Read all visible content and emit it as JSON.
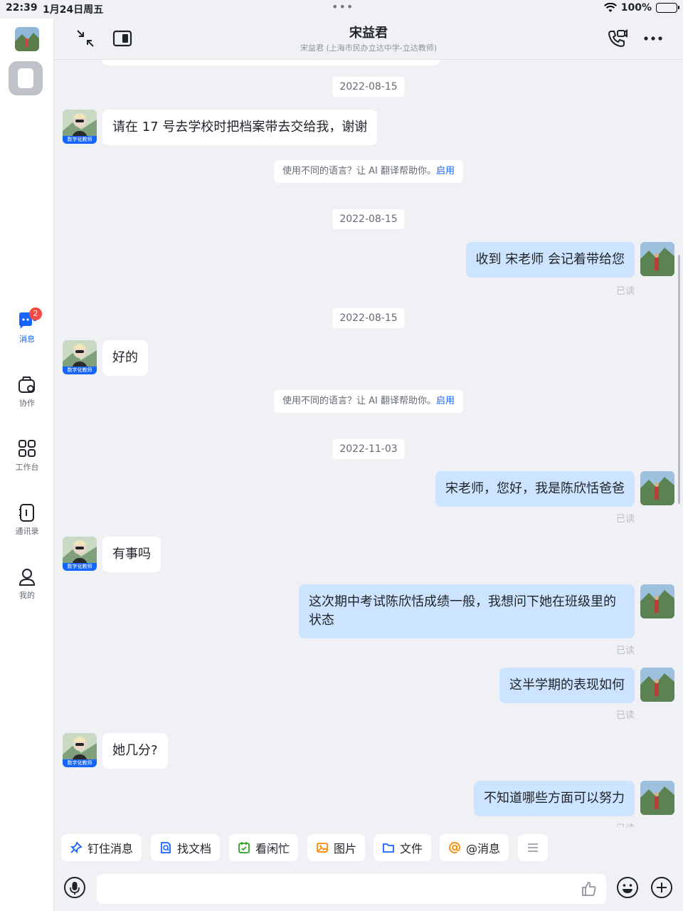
{
  "status_bar": {
    "time": "22:39",
    "date": "1月24日周五",
    "dots": "•••",
    "battery": "100%"
  },
  "sidebar": {
    "items": [
      {
        "label": "消息",
        "icon": "chat-icon",
        "badge": "2",
        "active": true
      },
      {
        "label": "协作",
        "icon": "collab-icon"
      },
      {
        "label": "工作台",
        "icon": "apps-grid-icon"
      },
      {
        "label": "通讯录",
        "icon": "contacts-icon"
      },
      {
        "label": "我的",
        "icon": "profile-icon"
      }
    ]
  },
  "header": {
    "title": "宋益君",
    "subtitle": "宋益君 (上海市民办立达中学-立达教师)"
  },
  "tag_text": "数字化教师",
  "messages": {
    "date1": "2022-08-15",
    "msg1": "请在 17 号去学校时把档案带去交给我，谢谢",
    "hint_text": "使用不同的语言？让 AI 翻译帮助你。",
    "hint_action": "启用",
    "date2": "2022-08-15",
    "msg2": "收到 宋老师 会记着带给您",
    "read_label": "已读",
    "date3": "2022-08-15",
    "msg3": "好的",
    "date4": "2022-11-03",
    "msg4": "宋老师，您好，我是陈欣恬爸爸",
    "msg5": "有事吗",
    "msg6": "这次期中考试陈欣恬成绩一般，我想问下她在班级里的状态",
    "msg7": "这半学期的表现如何",
    "msg8": "她几分?",
    "msg9": "不知道哪些方面可以努力"
  },
  "quick_actions": [
    "钉住消息",
    "找文档",
    "看闲忙",
    "图片",
    "文件",
    "@消息"
  ],
  "input": {
    "placeholder": ""
  },
  "colors": {
    "accent": "#1664ff",
    "out_bubble": "#cce4ff",
    "badge": "#f54a45"
  }
}
